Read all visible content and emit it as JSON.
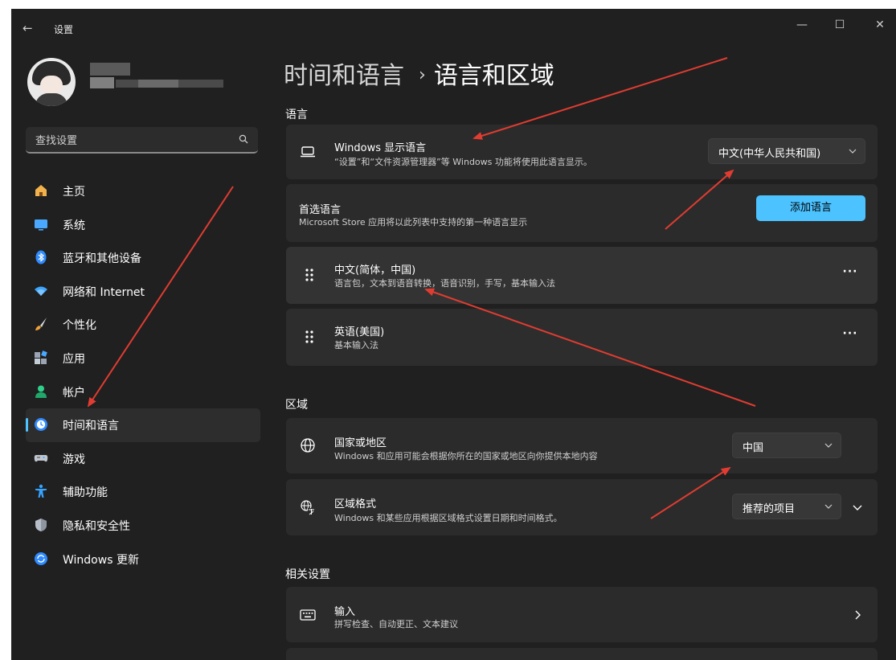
{
  "window": {
    "app_title": "设置",
    "back_glyph": "←",
    "min_glyph": "—",
    "max_glyph": "☐",
    "close_glyph": "✕"
  },
  "sidebar": {
    "search_placeholder": "查找设置",
    "items": [
      {
        "label": "主页",
        "icon": "home-icon"
      },
      {
        "label": "系统",
        "icon": "system-display-icon"
      },
      {
        "label": "蓝牙和其他设备",
        "icon": "bluetooth-icon"
      },
      {
        "label": "网络和 Internet",
        "icon": "wifi-icon"
      },
      {
        "label": "个性化",
        "icon": "brush-icon"
      },
      {
        "label": "应用",
        "icon": "apps-icon"
      },
      {
        "label": "帐户",
        "icon": "account-icon"
      },
      {
        "label": "时间和语言",
        "icon": "time-language-icon",
        "active": true
      },
      {
        "label": "游戏",
        "icon": "gamepad-icon"
      },
      {
        "label": "辅助功能",
        "icon": "accessibility-icon"
      },
      {
        "label": "隐私和安全性",
        "icon": "shield-icon"
      },
      {
        "label": "Windows 更新",
        "icon": "windows-update-icon"
      }
    ]
  },
  "main": {
    "breadcrumb_parent": "时间和语言",
    "breadcrumb_sep": "›",
    "breadcrumb_current": "语言和区域",
    "section_language": "语言",
    "display_language": {
      "title": "Windows 显示语言",
      "subtitle": "“设置”和“文件资源管理器”等 Windows 功能将使用此语言显示。",
      "value": "中文(中华人民共和国)"
    },
    "preferred": {
      "title": "首选语言",
      "subtitle": "Microsoft Store 应用将以此列表中支持的第一种语言显示",
      "button": "添加语言"
    },
    "languages": [
      {
        "title": "中文(简体，中国)",
        "subtitle": "语言包，文本到语音转换，语音识别，手写，基本输入法"
      },
      {
        "title": "英语(美国)",
        "subtitle": "基本输入法"
      }
    ],
    "more_label": "···",
    "section_region": "区域",
    "country": {
      "title": "国家或地区",
      "subtitle": "Windows 和应用可能会根据你所在的国家或地区向你提供本地内容",
      "value": "中国"
    },
    "format": {
      "title": "区域格式",
      "subtitle": "Windows 和某些应用根据区域格式设置日期和时间格式。",
      "value": "推荐的项目"
    },
    "section_related": "相关设置",
    "input": {
      "title": "输入",
      "subtitle": "拼写检查、自动更正、文本建议"
    }
  },
  "colors": {
    "background": "#202020",
    "card": "#2b2b2b",
    "accent": "#4cc2ff",
    "annotation_arrow": "#e03c31"
  }
}
